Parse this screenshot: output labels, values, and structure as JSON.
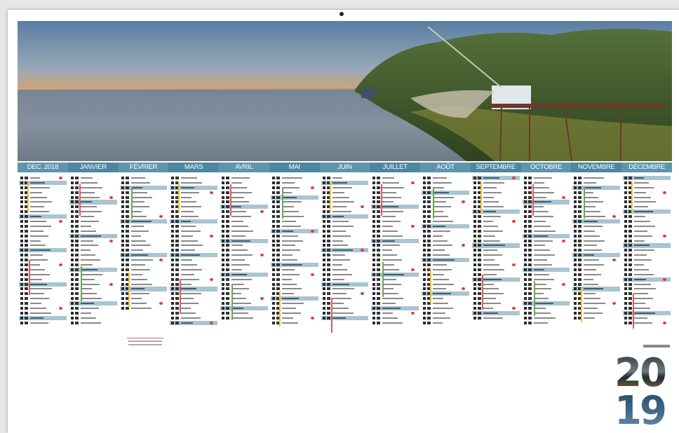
{
  "calendar": {
    "year_top": "20",
    "year_bottom": "19",
    "months": [
      "DEC. 2018",
      "JANVIER",
      "FÉVRIER",
      "MARS",
      "AVRIL",
      "MAI",
      "JUIN",
      "JUILLET",
      "AOÛT",
      "SEPTEMBRE",
      "OCTOBRE",
      "NOVEMBRE",
      "DÉCEMBRE"
    ],
    "days_in_month": [
      31,
      31,
      28,
      31,
      30,
      31,
      30,
      31,
      31,
      30,
      31,
      30,
      31
    ],
    "first_weekday_index": [
      5,
      1,
      4,
      4,
      0,
      2,
      5,
      0,
      3,
      6,
      1,
      4,
      6
    ]
  },
  "colors": {
    "header_band": "#5e95ad",
    "weekend_row": "#a9c4d2",
    "holiday_dot": "#e03a3a",
    "school_bars": [
      "#f0c341",
      "#e05a5a",
      "#6aa84f"
    ]
  }
}
